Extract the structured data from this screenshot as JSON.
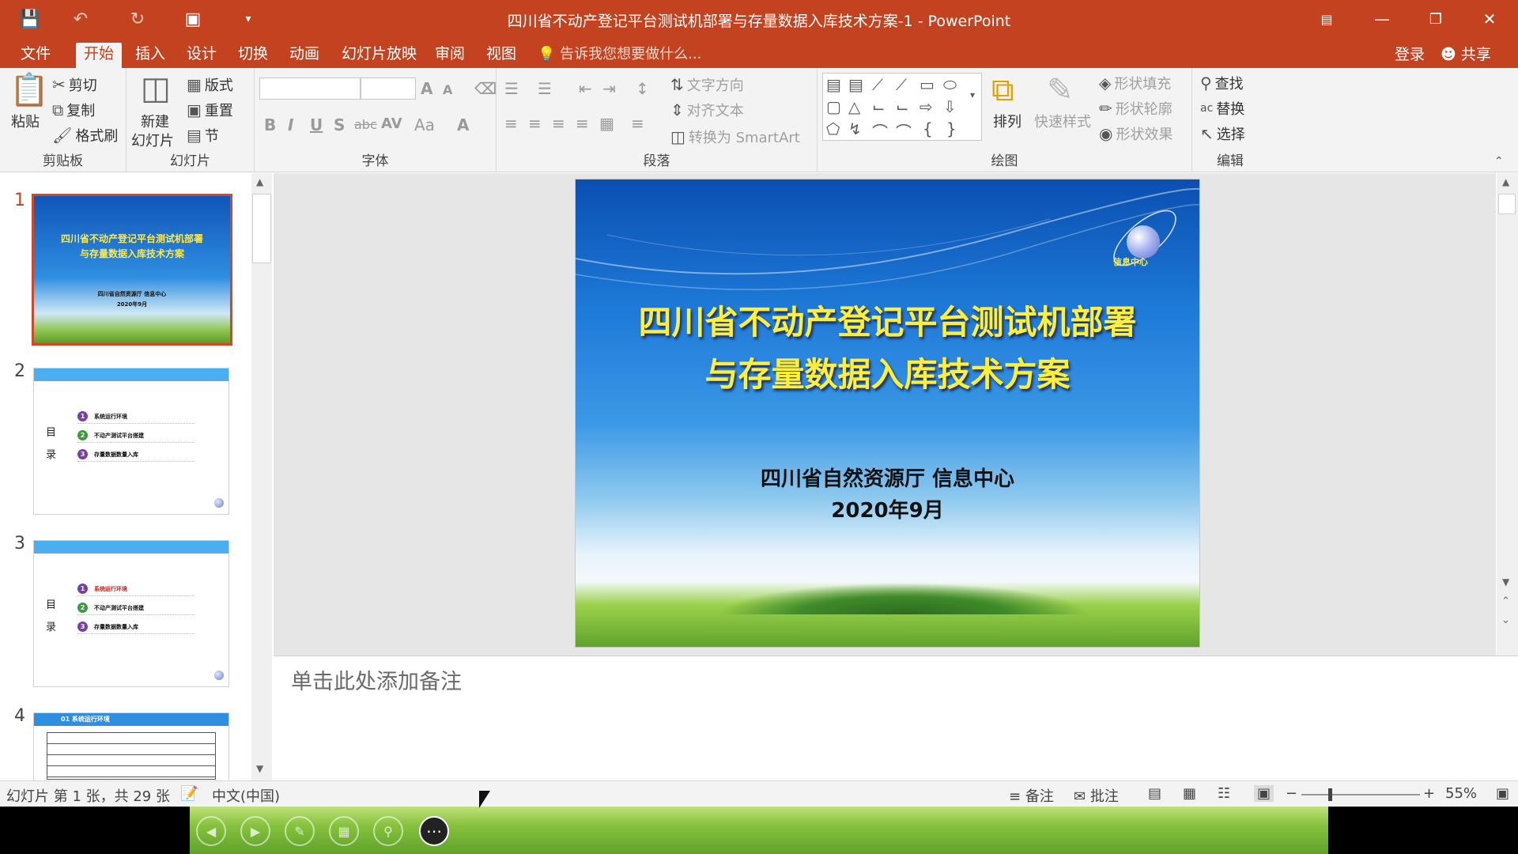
{
  "app": {
    "title": "四川省不动产登记平台测试机部署与存量数据入库技术方案-1 - PowerPoint",
    "accent_color": "#c34320"
  },
  "quick_access": [
    "save-icon",
    "undo-icon",
    "redo-icon",
    "present-icon",
    "customize-icon"
  ],
  "menu": {
    "tabs": [
      "文件",
      "开始",
      "插入",
      "设计",
      "切换",
      "动画",
      "幻灯片放映",
      "审阅",
      "视图"
    ],
    "active_tab": "开始",
    "tell_me": "告诉我您想要做什么...",
    "login": "登录",
    "share": "共享"
  },
  "ribbon": {
    "clipboard": {
      "paste": "粘贴",
      "cut": "剪切",
      "copy": "复制",
      "format_painter": "格式刷",
      "label": "剪贴板"
    },
    "slides": {
      "new_slide_line1": "新建",
      "new_slide_line2": "幻灯片",
      "layout": "版式",
      "reset": "重置",
      "section": "节",
      "label": "幻灯片"
    },
    "font": {
      "label": "字体",
      "bold": "B",
      "italic": "I",
      "underline": "U",
      "shadow": "S",
      "strike": "abc",
      "spacing": "AV",
      "case": "Aa",
      "color": "A"
    },
    "paragraph": {
      "text_direction": "文字方向",
      "align_text": "对齐文本",
      "smartart": "转换为 SmartArt",
      "label": "段落"
    },
    "drawing": {
      "arrange": "排列",
      "quick_styles": "快速样式",
      "shape_fill": "形状填充",
      "shape_outline": "形状轮廓",
      "shape_effects": "形状效果",
      "label": "绘图"
    },
    "editing": {
      "find": "查找",
      "replace": "替换",
      "select": "选择",
      "label": "编辑"
    }
  },
  "thumbnails": [
    {
      "num": "1",
      "title_line1": "四川省不动产登记平台测试机部署",
      "title_line2": "与存量数据入库技术方案",
      "sub_line1": "四川省自然资源厅 信息中心",
      "sub_line2": "2020年9月"
    },
    {
      "num": "2",
      "side": "目",
      "side2": "录",
      "items": [
        "系统运行环境",
        "不动产测试平台搭建",
        "存量数据数量入库"
      ]
    },
    {
      "num": "3",
      "side": "目",
      "side2": "录",
      "items": [
        "系统运行环境",
        "不动产测试平台搭建",
        "存量数据数量入库"
      ]
    },
    {
      "num": "4",
      "header": "01 系统运行环境"
    }
  ],
  "slide": {
    "title_line1": "四川省不动产登记平台测试机部署",
    "title_line2": "与存量数据入库技术方案",
    "org": "四川省自然资源厅 信息中心",
    "date": "2020年9月",
    "logo_text": "信息中心"
  },
  "notes_placeholder": "单击此处添加备注",
  "status": {
    "slide_info": "幻灯片 第 1 张，共 29 张",
    "language": "中文(中国)",
    "notes": "备注",
    "comments": "批注",
    "zoom": "55%"
  },
  "presenter_controls": [
    "prev-icon",
    "next-icon",
    "pen-icon",
    "grid-icon",
    "zoom-icon",
    "more-icon"
  ]
}
